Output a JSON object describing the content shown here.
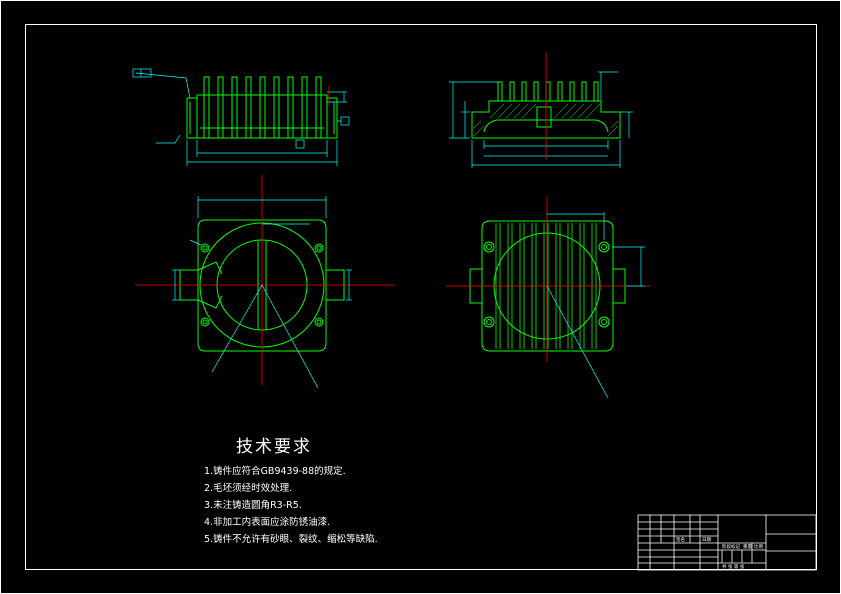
{
  "colors": {
    "background": "#000000",
    "frame": "#ffffff",
    "outline": "#00ff00",
    "centerline": "#ff0000",
    "dimension": "#00ffff",
    "text": "#ffffff",
    "titleblock": "#ffffff"
  },
  "tech_requirements": {
    "title": "技术要求",
    "items": [
      "1.铸件应符合GB9439-88的规定.",
      "2.毛坯须经时效处理.",
      "3.未注铸造圆角R3-R5.",
      "4.非加工内表面应涂防锈油漆.",
      "5.铸件不允许有砂眼、裂纹、缩松等缺陷."
    ]
  },
  "title_block": {
    "label_sign": "签名",
    "label_date": "日期",
    "label_stage": "阶段标记",
    "label_weight": "重量",
    "label_scale": "比例",
    "label_sheet": "共 张 第 张"
  }
}
